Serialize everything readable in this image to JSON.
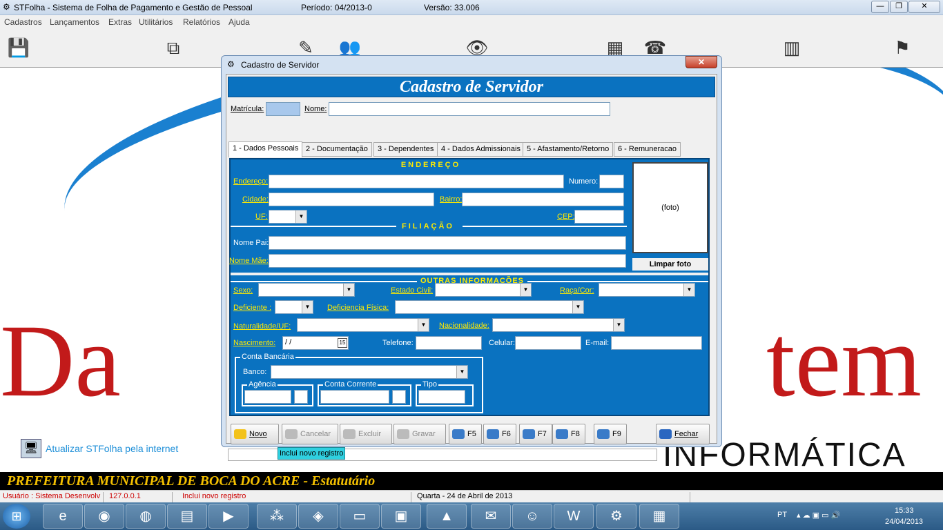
{
  "app": {
    "title": "STFolha - Sistema de Folha de Pagamento e Gestão de Pessoal",
    "periodo": "Período: 04/2013-0",
    "versao": "Versão: 33.006",
    "min_glyph": "—",
    "max_glyph": "❐",
    "close_glyph": "✕"
  },
  "menu": [
    "Cadastros",
    "Lançamentos",
    "Extras",
    "Utilitários",
    "Relatórios",
    "Ajuda"
  ],
  "toolbar_icons": [
    "save-icon",
    "cubes-icon",
    "edit-icon",
    "people-icon",
    "eye-icon",
    "calculator-icon",
    "phone-icon",
    "books-icon",
    "runner-icon"
  ],
  "desktop": {
    "update_link": "Atualizar STFolha pela internet",
    "brand_letters_left": "Da",
    "brand_letters_right": "tem",
    "brand_sub": "INFORMÁTICA"
  },
  "footer": {
    "org": "PREFEITURA MUNICIPAL DE BOCA DO ACRE - Estatutário"
  },
  "status": {
    "user": "Usuário : Sistema Desenvolv",
    "ip": "127.0.0.1",
    "msg": "Inclui novo registro",
    "date": "Quarta - 24 de Abril de 2013"
  },
  "dialog": {
    "title": "Cadastro de Servidor",
    "header": "Cadastro de Servidor",
    "matricula_label": "Matrícula:",
    "matricula_value": "",
    "nome_label": "Nome:",
    "nome_value": "",
    "tabs": [
      "1 - Dados Pessoais",
      "2 - Documentação",
      "3 - Dependentes",
      "4 - Dados Admissionais",
      "5 - Afastamento/Retorno",
      "6 - Remuneracao"
    ],
    "endereco_section": "ENDEREÇO",
    "filiacao_section": "FILIAÇÃO",
    "outras_section": "OUTRAS INFORMAÇÕES",
    "fields": {
      "endereco": "Endereço:",
      "numero": "Numero:",
      "cidade": "Cidade:",
      "bairro": "Bairro:",
      "uf": "UF:",
      "cep": "CEP:",
      "nome_pai": "Nome Pai:",
      "nome_mae": "Nome Mãe:",
      "sexo": "Sexo:",
      "estado_civil": "Estado Civil:",
      "raca_cor": "Raça/Cor:",
      "deficiente": "Deficiente :",
      "deficiencia_fisica": "Deficiencia Física:",
      "naturalidade": "Naturalidade/UF:",
      "nacionalidade": "Nacionalidade:",
      "nascimento": "Nascimento:",
      "nascimento_value": " /  /",
      "telefone": "Telefone:",
      "celular": "Celular:",
      "email": "E-mail:",
      "conta_bancaria": "Conta Bancária",
      "banco": "Banco:",
      "agencia": "Agência",
      "conta_corrente": "Conta Corrente",
      "tipo": "Tipo"
    },
    "foto_placeholder": "(foto)",
    "limpar_foto": "Limpar foto",
    "buttons": {
      "novo": "Novo",
      "cancelar": "Cancelar",
      "excluir": "Excluir",
      "gravar": "Gravar",
      "f5": "F5",
      "f6": "F6",
      "f7": "F7",
      "f8": "F8",
      "f9": "F9",
      "fechar": "Fechar"
    },
    "tooltip": "Inclui novo registro",
    "calendar_glyph": "15"
  },
  "taskbar": {
    "lang": "PT",
    "time": "15:33",
    "date": "24/04/2013",
    "apps": [
      "ie-icon",
      "firefox-icon",
      "chrome-icon",
      "explorer-icon",
      "media-icon",
      "ibge-icon",
      "brazil-icon",
      "window-icon",
      "winrar-icon",
      "vlc-icon",
      "mail-icon",
      "messenger-icon",
      "word-icon",
      "settings-icon",
      "desktop-icon"
    ]
  },
  "colors": {
    "dialog_blue": "#0a72c0",
    "section_yellow": "#ffea00",
    "brand_red": "#c21a1a",
    "footer_gold": "#f4c000",
    "tooltip_cyan": "#2fd0e0"
  }
}
